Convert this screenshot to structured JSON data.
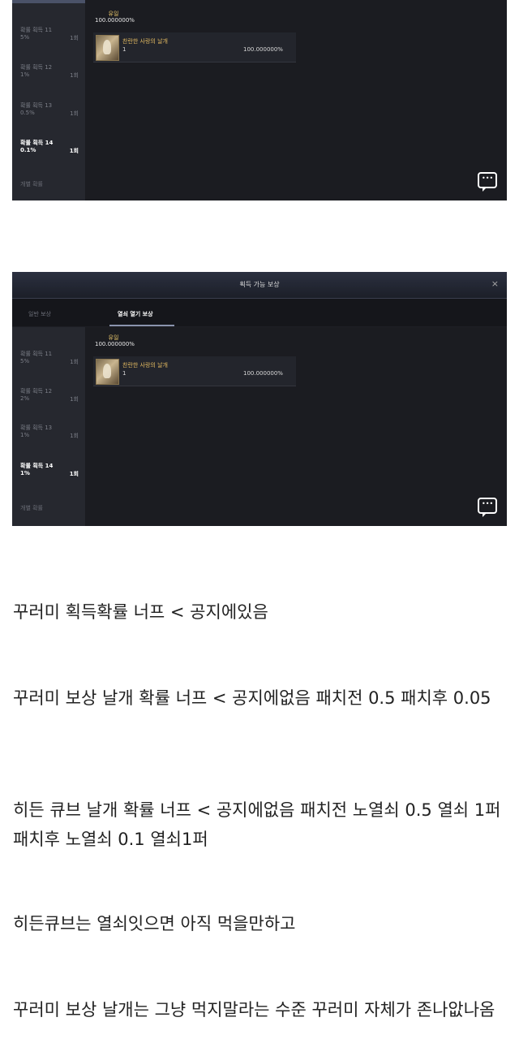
{
  "panel1": {
    "grade": {
      "label": "유일",
      "pct": "100.000000%"
    },
    "item": {
      "name": "찬란한 사랑의 날개",
      "qty": "1",
      "pct": "100.000000%"
    },
    "sidebar": [
      {
        "title": "확률 획득 11",
        "pct": "5%",
        "count": "1회"
      },
      {
        "title": "확률 획득 12",
        "pct": "1%",
        "count": "1회"
      },
      {
        "title": "확률 획득 13",
        "pct": "0.5%",
        "count": "1회"
      },
      {
        "title": "확률 획득 14",
        "pct": "0.1%",
        "count": "1회"
      },
      {
        "title": "개별 확률",
        "pct": "",
        "count": ""
      }
    ]
  },
  "panel2": {
    "header": {
      "title": "획득 가능 보상",
      "close": "×"
    },
    "tabs": [
      "일반 보상",
      "열쇠 열기 보상"
    ],
    "grade": {
      "label": "유일",
      "pct": "100.000000%"
    },
    "item": {
      "name": "찬란한 사랑의 날개",
      "qty": "1",
      "pct": "100.000000%"
    },
    "sidebar": [
      {
        "title": "확률 획득 11",
        "pct": "5%",
        "count": "1회"
      },
      {
        "title": "확률 획득 12",
        "pct": "2%",
        "count": "1회"
      },
      {
        "title": "확률 획득 13",
        "pct": "1%",
        "count": "1회"
      },
      {
        "title": "확률 획득 14",
        "pct": "1%",
        "count": "1회"
      },
      {
        "title": "개별 확률",
        "pct": "",
        "count": ""
      }
    ]
  },
  "post": {
    "lines": [
      "꾸러미 획득확률 너프 < 공지에있음",
      "꾸러미 보상 날개 확률 너프 < 공지에없음 패치전 0.5 패치후 0.05",
      "히든 큐브 날개 확률 너프 < 공지에없음 패치전 노열쇠 0.5 열쇠 1퍼 패치후 노열쇠 0.1 열쇠1퍼",
      "히든큐브는 열쇠잇으면 아직 먹을만하고",
      "꾸러미 보상 날개는 그냥 먹지말라는 수준 꾸러미 자체가 존나앖나옴"
    ]
  }
}
